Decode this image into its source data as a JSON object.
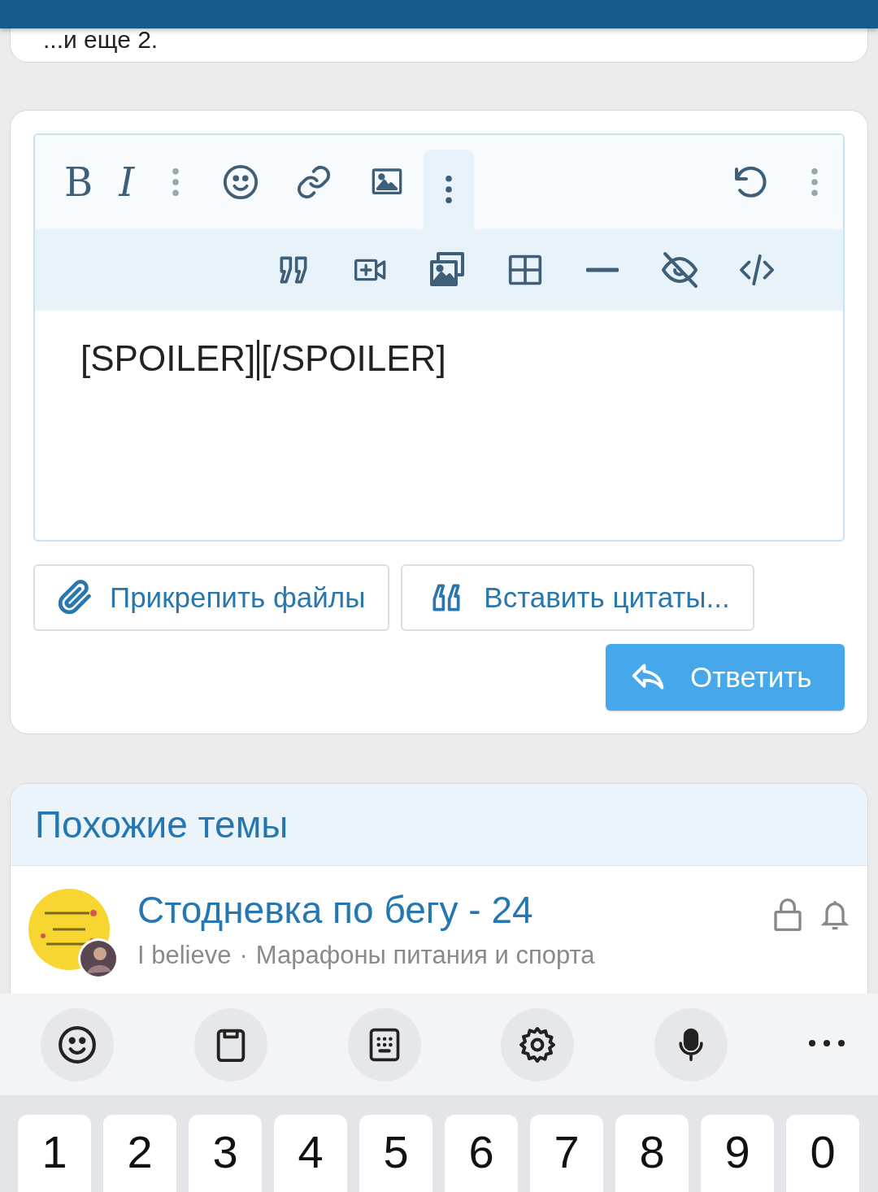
{
  "previous_post": {
    "more_text": "...и еще 2."
  },
  "editor": {
    "toolbar": {
      "bold": "B",
      "italic": "I",
      "more_expanded": true
    },
    "content_before_caret": "[SPOILER]",
    "content_after_caret": "[/SPOILER]"
  },
  "buttons": {
    "attach": "Прикрепить файлы",
    "insert_quotes": "Вставить цитаты...",
    "reply": "Ответить"
  },
  "similar": {
    "title": "Похожие темы",
    "threads": [
      {
        "title": "Стодневка по бегу - 24",
        "author": "I believe",
        "separator": "·",
        "forum": "Марафоны питания и спорта",
        "locked": true
      }
    ]
  },
  "keyboard": {
    "keys": [
      "1",
      "2",
      "3",
      "4",
      "5",
      "6",
      "7",
      "8",
      "9",
      "0"
    ]
  }
}
